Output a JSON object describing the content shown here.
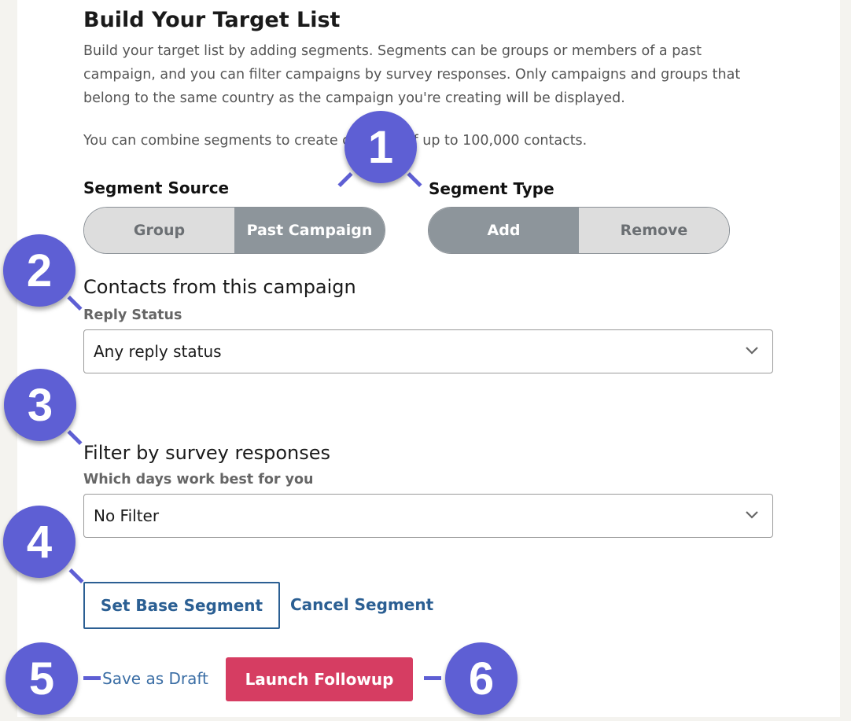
{
  "header": {
    "title": "Build Your Target List",
    "description": "Build your target list by adding segments. Segments can be groups or members of a past campaign, and you can filter campaigns by survey responses. Only campaigns and groups that belong to the same country as the campaign you're creating will be displayed.",
    "combine_prefix": "You can combine segments to create c",
    "combine_suffix": "of up to 100,000 contacts."
  },
  "segment_source": {
    "label": "Segment Source",
    "options": [
      "Group",
      "Past Campaign"
    ],
    "selected": "Past Campaign"
  },
  "segment_type": {
    "label": "Segment Type",
    "options": [
      "Add",
      "Remove"
    ],
    "selected": "Add"
  },
  "contacts": {
    "heading": "Contacts from this campaign",
    "field_label": "Reply Status",
    "value": "Any reply status"
  },
  "survey_filter": {
    "heading": "Filter by survey responses",
    "field_label": "Which days work best for you",
    "value": "No Filter"
  },
  "actions": {
    "set_base": "Set Base Segment",
    "cancel": "Cancel Segment",
    "save_draft": "Save as Draft",
    "launch": "Launch Followup"
  },
  "callouts": [
    "1",
    "2",
    "3",
    "4",
    "5",
    "6"
  ],
  "colors": {
    "accent_link": "#2b5f93",
    "launch_button": "#d63d62",
    "callout_badge": "#5e5fd4",
    "toggle_selected": "#8d959b",
    "toggle_unselected": "#dddddd"
  }
}
